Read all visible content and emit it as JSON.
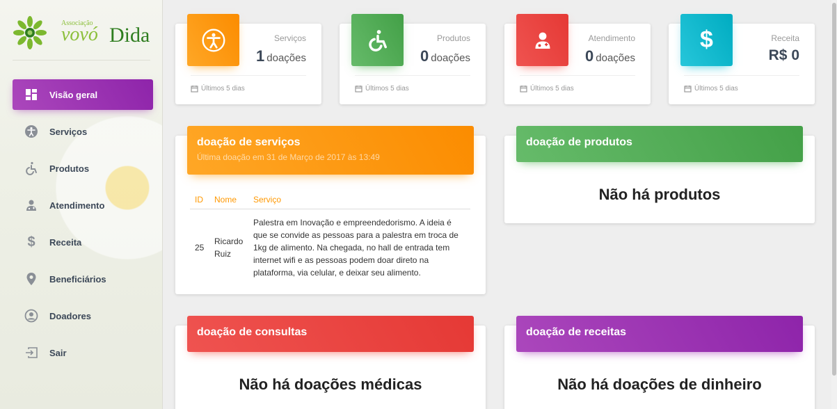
{
  "brand": {
    "association": "Associação",
    "name_part1": "vovó",
    "name_part2": "Dida"
  },
  "sidebar": {
    "items": [
      {
        "label": "Visão geral",
        "icon": "dashboard-icon",
        "active": true
      },
      {
        "label": "Serviços",
        "icon": "accessibility-icon"
      },
      {
        "label": "Produtos",
        "icon": "wheelchair-icon"
      },
      {
        "label": "Atendimento",
        "icon": "doctor-icon"
      },
      {
        "label": "Receita",
        "icon": "dollar-icon"
      },
      {
        "label": "Beneficiários",
        "icon": "map-pin-icon"
      },
      {
        "label": "Doadores",
        "icon": "user-circle-icon"
      },
      {
        "label": "Sair",
        "icon": "exit-icon"
      }
    ]
  },
  "stats": [
    {
      "label": "Serviços",
      "value": "1",
      "unit": "doações",
      "footer": "Últimos 5 dias",
      "icon": "accessibility-icon",
      "color": "#fb8c00"
    },
    {
      "label": "Produtos",
      "value": "0",
      "unit": "doações",
      "footer": "Últimos 5 dias",
      "icon": "wheelchair-icon",
      "color": "#43a047"
    },
    {
      "label": "Atendimento",
      "value": "0",
      "unit": "doações",
      "footer": "Últimos 5 dias",
      "icon": "doctor-icon",
      "color": "#e53935"
    },
    {
      "label": "Receita",
      "value": "R$ 0",
      "unit": "",
      "footer": "Últimos 5 dias",
      "icon": "dollar-icon",
      "color": "#00acc1"
    }
  ],
  "panels": {
    "services": {
      "title": "doação de serviços",
      "subtitle": "Última doação em 31 de Março de 2017 às 13:49",
      "columns": [
        "ID",
        "Nome",
        "Serviço"
      ],
      "rows": [
        {
          "id": "25",
          "name": "Ricardo Ruiz",
          "service": "Palestra em Inovação e empreendedorismo. A ideia é que se convide as pessoas para a palestra em troca de 1kg de alimento. Na chegada, no hall de entrada tem internet wifi e as pessoas podem doar direto na plataforma, via celular, e deixar seu alimento."
        }
      ]
    },
    "products": {
      "title": "doação de produtos",
      "empty": "Não há produtos"
    },
    "consultations": {
      "title": "doação de consultas",
      "empty": "Não há doações médicas"
    },
    "recipes": {
      "title": "doação de receitas",
      "empty": "Não há doações de dinheiro"
    }
  },
  "colors": {
    "orange": "#fb8c00",
    "green": "#43a047",
    "red": "#e53935",
    "cyan": "#00acc1",
    "purple": "#8e24aa"
  }
}
